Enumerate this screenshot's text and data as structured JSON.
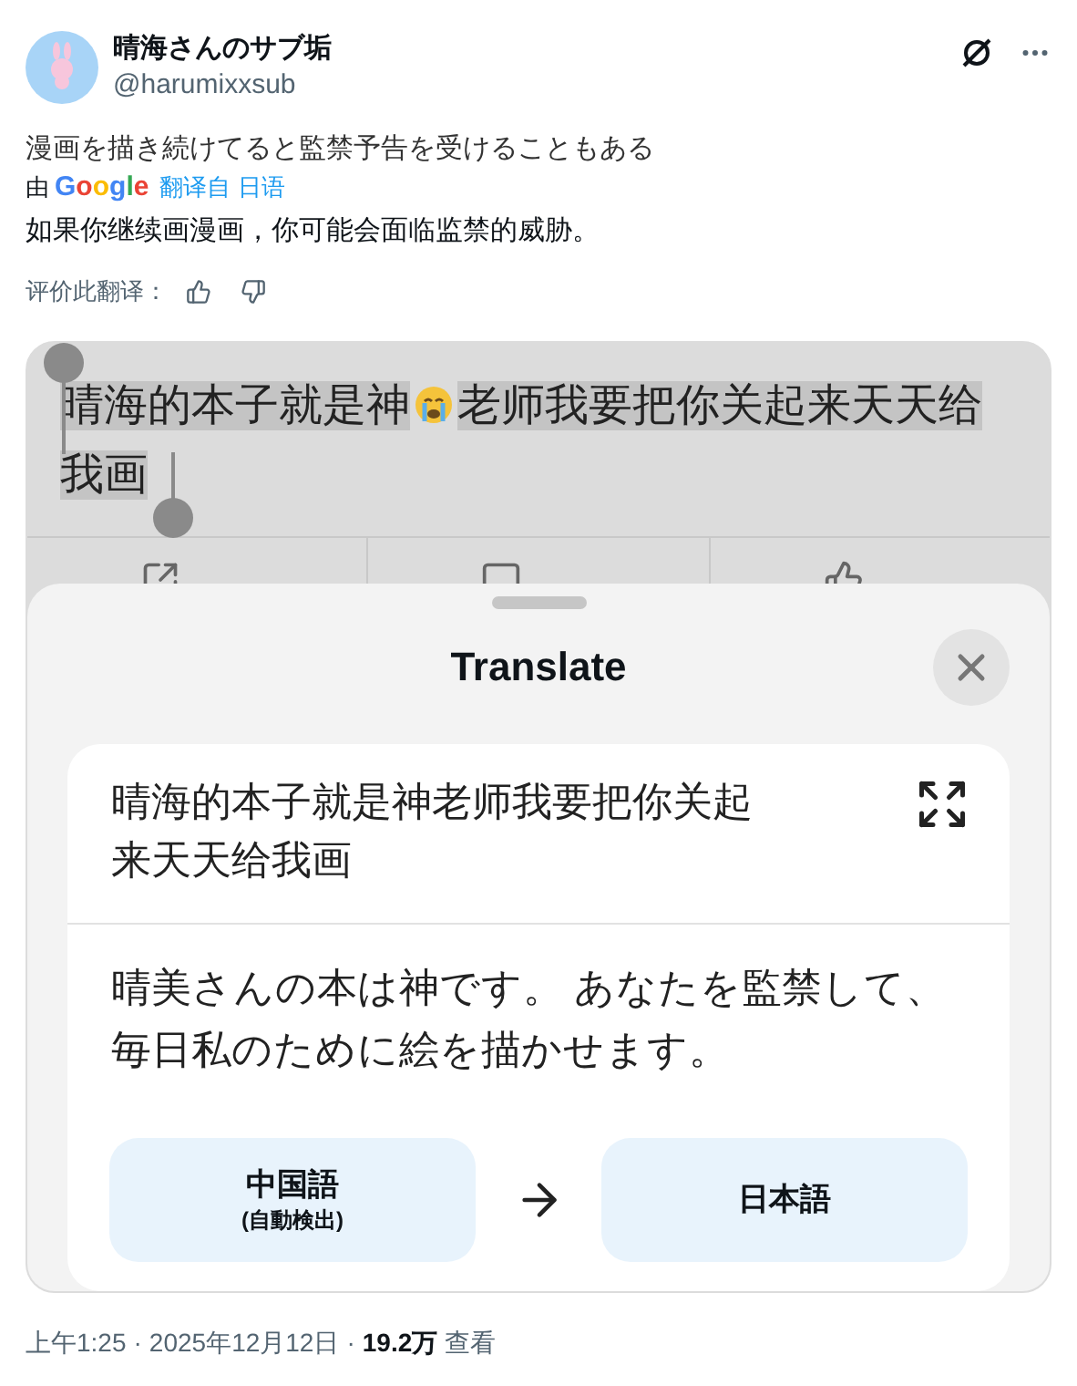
{
  "author": {
    "name": "晴海さんのサブ垢",
    "handle": "@harumixxsub"
  },
  "post": {
    "text": "漫画を描き続けてると監禁予告を受けることもある",
    "by": "由",
    "translator": "Google",
    "from": "翻译自 日语",
    "translation": "如果你继续画漫画，你可能会面临监禁的威胁。",
    "rate_label": "评价此翻译："
  },
  "screenshot": {
    "comment_start": "晴海的本子就是神",
    "comment_end": "老师我要把你关起来天天给我画",
    "selected": true,
    "sheet": {
      "title": "Translate",
      "source": "晴海的本子就是神老师我要把你关起来天天给我画",
      "result": "晴美さんの本は神です。 あなたを監禁して、毎日私のために絵を描かせます。",
      "from": {
        "name": "中国語",
        "note": "(自動検出)"
      },
      "to": {
        "name": "日本語"
      }
    }
  },
  "footer": {
    "time": "上午1:25",
    "separator": "·",
    "date": "2025年12月12日",
    "views": "19.2万",
    "views_label": "查看"
  }
}
